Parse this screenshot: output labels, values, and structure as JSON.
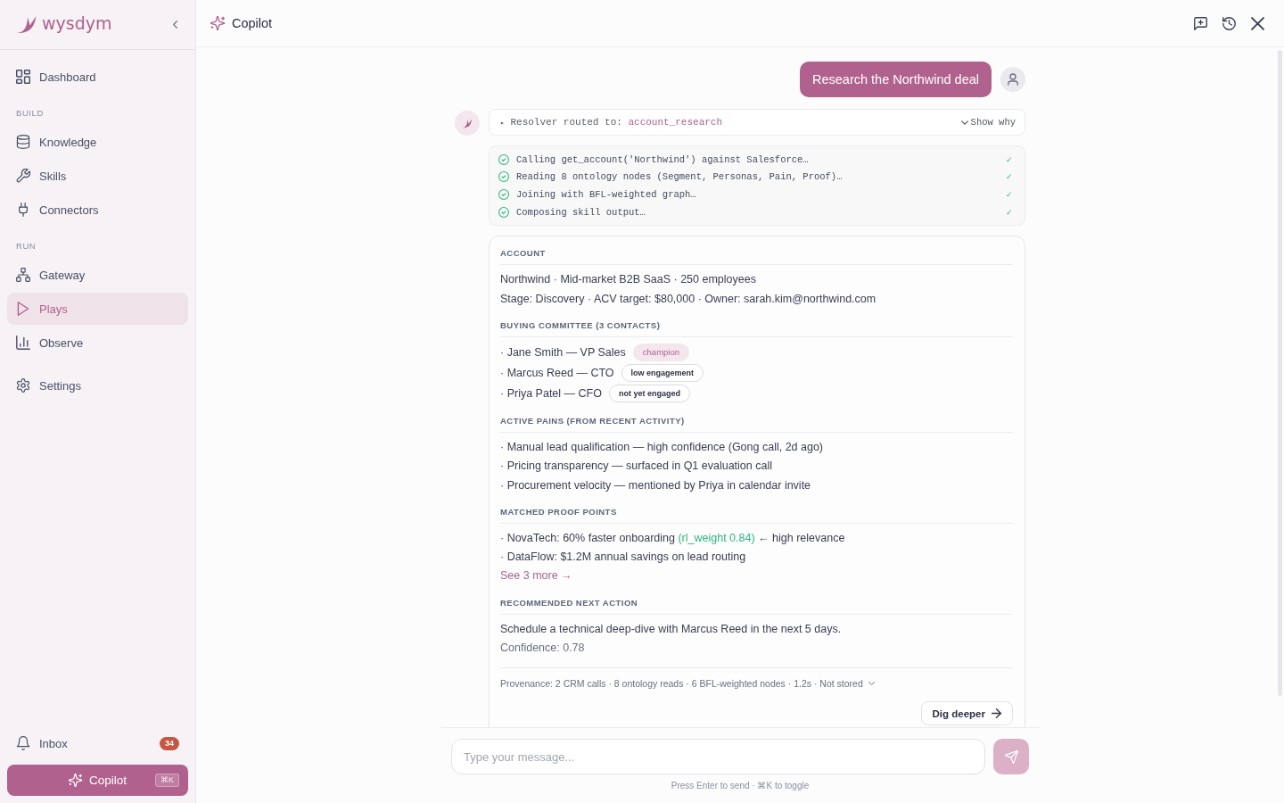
{
  "sidebar": {
    "logo": "wysdym",
    "groups": [
      {
        "items": [
          {
            "label": "Dashboard",
            "selected": false
          }
        ]
      },
      {
        "heading": "BUILD",
        "items": [
          {
            "label": "Knowledge",
            "selected": false
          },
          {
            "label": "Skills",
            "selected": false
          },
          {
            "label": "Connectors",
            "selected": false
          }
        ]
      },
      {
        "heading": "RUN",
        "items": [
          {
            "label": "Gateway",
            "selected": false
          },
          {
            "label": "Plays",
            "selected": true
          },
          {
            "label": "Observe",
            "selected": false
          }
        ]
      },
      {
        "items": [
          {
            "label": "Settings",
            "selected": false
          }
        ]
      }
    ],
    "inbox": {
      "label": "Inbox",
      "count": "34",
      "selected": false
    },
    "copilot_button": {
      "label": "Copilot",
      "shortcut": "⌘K"
    }
  },
  "header": {
    "title": "Copilot"
  },
  "chat": {
    "user_message": "Research the Northwind deal",
    "resolver": {
      "marker": "▸",
      "label": "Resolver routed to:",
      "route": "account_research",
      "toggle": "Show why"
    },
    "steps": [
      {
        "text": "Calling get_account('Northwind') against Salesforce…",
        "done": true,
        "tick": "✓"
      },
      {
        "text": "Reading 8 ontology nodes (Segment, Personas, Pain, Proof)…",
        "done": true,
        "tick": "✓"
      },
      {
        "text": "Joining with BFL-weighted graph…",
        "done": true,
        "tick": "✓"
      },
      {
        "text": "Composing skill output…",
        "done": true,
        "tick": "✓"
      }
    ],
    "result": {
      "sections": [
        {
          "kind": "lines",
          "title": "ACCOUNT",
          "lines": [
            "Northwind · Mid-market B2B SaaS · 250 employees",
            "Stage: Discovery · ACV target: $80,000 · Owner: sarah.kim@northwind.com"
          ]
        },
        {
          "kind": "contacts",
          "title": "BUYING COMMITTEE (3 CONTACTS)",
          "contacts": [
            {
              "name": "· Jane Smith — VP Sales",
              "tag": {
                "label": "champion",
                "kind": "accent"
              }
            },
            {
              "name": "· Marcus Reed — CTO",
              "tag": {
                "label": "low engagement",
                "kind": "outline"
              }
            },
            {
              "name": "· Priya Patel — CFO",
              "tag": {
                "label": "not yet engaged",
                "kind": "outline"
              }
            }
          ]
        },
        {
          "kind": "lines",
          "title": "ACTIVE PAINS (FROM RECENT ACTIVITY)",
          "lines": [
            "· Manual lead qualification — high confidence (Gong call, 2d ago)",
            "· Pricing transparency — surfaced in Q1 evaluation call",
            "· Procurement velocity — mentioned by Priya in calendar invite"
          ]
        },
        {
          "kind": "proof",
          "title": "MATCHED PROOF POINTS",
          "items": [
            {
              "text": "· NovaTech: 60% faster onboarding",
              "weight": "(rl_weight 0.84)",
              "note": "← high relevance"
            },
            {
              "text": "· DataFlow: $1.2M annual savings on lead routing"
            }
          ],
          "link": "See 3 more →"
        },
        {
          "kind": "action",
          "title": "RECOMMENDED NEXT ACTION",
          "text": "Schedule a technical deep-dive with Marcus Reed in the next 5 days.",
          "confidence": "Confidence: 0.78"
        }
      ],
      "provenance": "Provenance: 2 CRM calls · 8 ontology reads · 6 BFL-weighted nodes · 1.2s · Not stored",
      "action": "Dig deeper"
    }
  },
  "composer": {
    "placeholder": "Type your message...",
    "hint": "Press Enter to send · ⌘K to toggle"
  }
}
